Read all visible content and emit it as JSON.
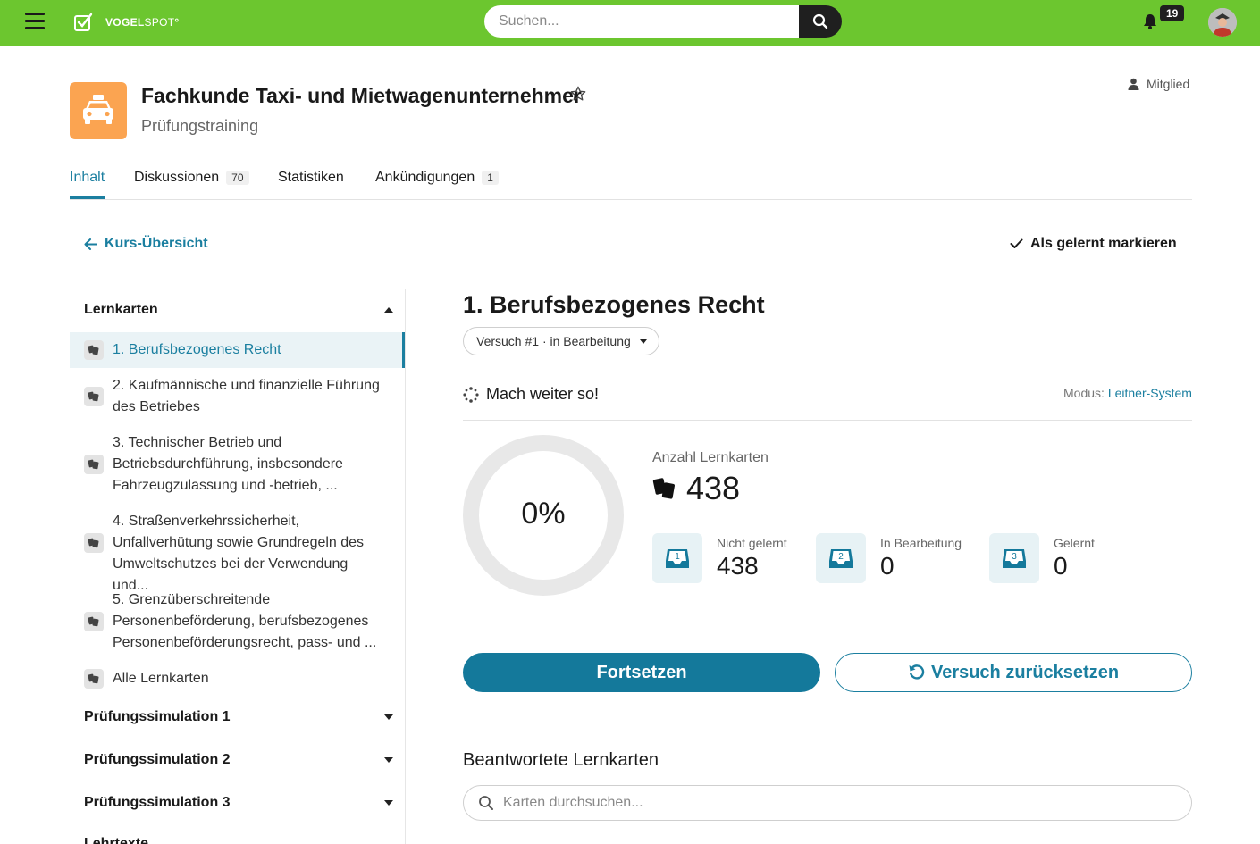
{
  "header": {
    "brand_bold": "VOGEL",
    "brand_light": "SPOT",
    "search_placeholder": "Suchen...",
    "notifications": "19"
  },
  "course": {
    "title": "Fachkunde Taxi- und Mietwagenunternehmer",
    "subtitle": "Prüfungstraining",
    "role": "Mitglied"
  },
  "tabs": [
    {
      "label": "Inhalt"
    },
    {
      "label": "Diskussionen",
      "count": "70"
    },
    {
      "label": "Statistiken"
    },
    {
      "label": "Ankündigungen",
      "count": "1"
    }
  ],
  "nav": {
    "back": "Kurs-Übersicht",
    "mark_learned": "Als gelernt markieren"
  },
  "sidebar": {
    "section_lernkarten": "Lernkarten",
    "items": [
      {
        "l1": "1. Berufsbezogenes Recht"
      },
      {
        "l1": "2. Kaufmännische und finanzielle Führung",
        "l2": "des Betriebes"
      },
      {
        "l1": "3. Technischer Betrieb und",
        "l2": "Betriebsdurchführung, insbesondere",
        "l3": "Fahrzeugzulassung und -betrieb, ..."
      },
      {
        "l1": "4. Straßenverkehrssicherheit,",
        "l2": "Unfallverhütung sowie Grundregeln des",
        "l3": "Umweltschutzes bei der Verwendung und..."
      },
      {
        "l1": "5. Grenzüberschreitende",
        "l2": "Personenbeförderung, berufsbezogenes",
        "l3": "Personenbeförderungsrecht, pass- und ..."
      },
      {
        "l1": "Alle Lernkarten"
      }
    ],
    "sim1": "Prüfungssimulation 1",
    "sim2": "Prüfungssimulation 2",
    "sim3": "Prüfungssimulation 3",
    "lehrtexte": "Lehrtexte"
  },
  "main": {
    "title": "1. Berufsbezogenes Recht",
    "attempt": "Versuch #1 · in Bearbeitung",
    "motivation": "Mach weiter so!",
    "mode_label": "Modus: ",
    "mode_value": "Leitner-System",
    "progress": "0%",
    "progress_fraction": 0,
    "count_label": "Anzahl Lernkarten",
    "count_value": "438",
    "boxes": [
      {
        "num": "1",
        "label": "Nicht gelernt",
        "value": "438"
      },
      {
        "num": "2",
        "label": "In Bearbeitung",
        "value": "0"
      },
      {
        "num": "3",
        "label": "Gelernt",
        "value": "0"
      }
    ],
    "continue": "Fortsetzen",
    "reset": "Versuch zurücksetzen",
    "answered_title": "Beantwortete Lernkarten",
    "card_search_placeholder": "Karten durchsuchen..."
  },
  "colors": {
    "brand_green": "#6cc62f",
    "accent": "#1b7fa0",
    "button": "#14799b",
    "course_icon": "#fba451"
  }
}
